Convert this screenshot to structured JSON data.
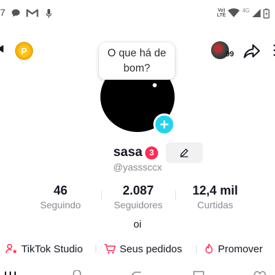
{
  "status_bar": {
    "time_fragment": "7",
    "volte": [
      "Vo)",
      "LTE"
    ],
    "network": "4G"
  },
  "top_bar": {
    "coin_letter": "P",
    "friends_count": "99"
  },
  "bubble": {
    "text": "O que há de bom?"
  },
  "profile": {
    "username": "sasa",
    "badge_count": "3",
    "handle": "@yassscсx",
    "bio": "oi"
  },
  "stats": [
    {
      "value": "46",
      "label": "Seguindo"
    },
    {
      "value": "2.087",
      "label": "Seguidores"
    },
    {
      "value": "12,4 mil",
      "label": "Curtidas"
    }
  ],
  "links": {
    "studio": "TikTok Studio",
    "orders": "Seus pedidos",
    "promote": "Promover"
  },
  "colors": {
    "accent_red": "#fe2c55",
    "accent_cyan": "#20d5ec",
    "coin": "#f5b400"
  }
}
